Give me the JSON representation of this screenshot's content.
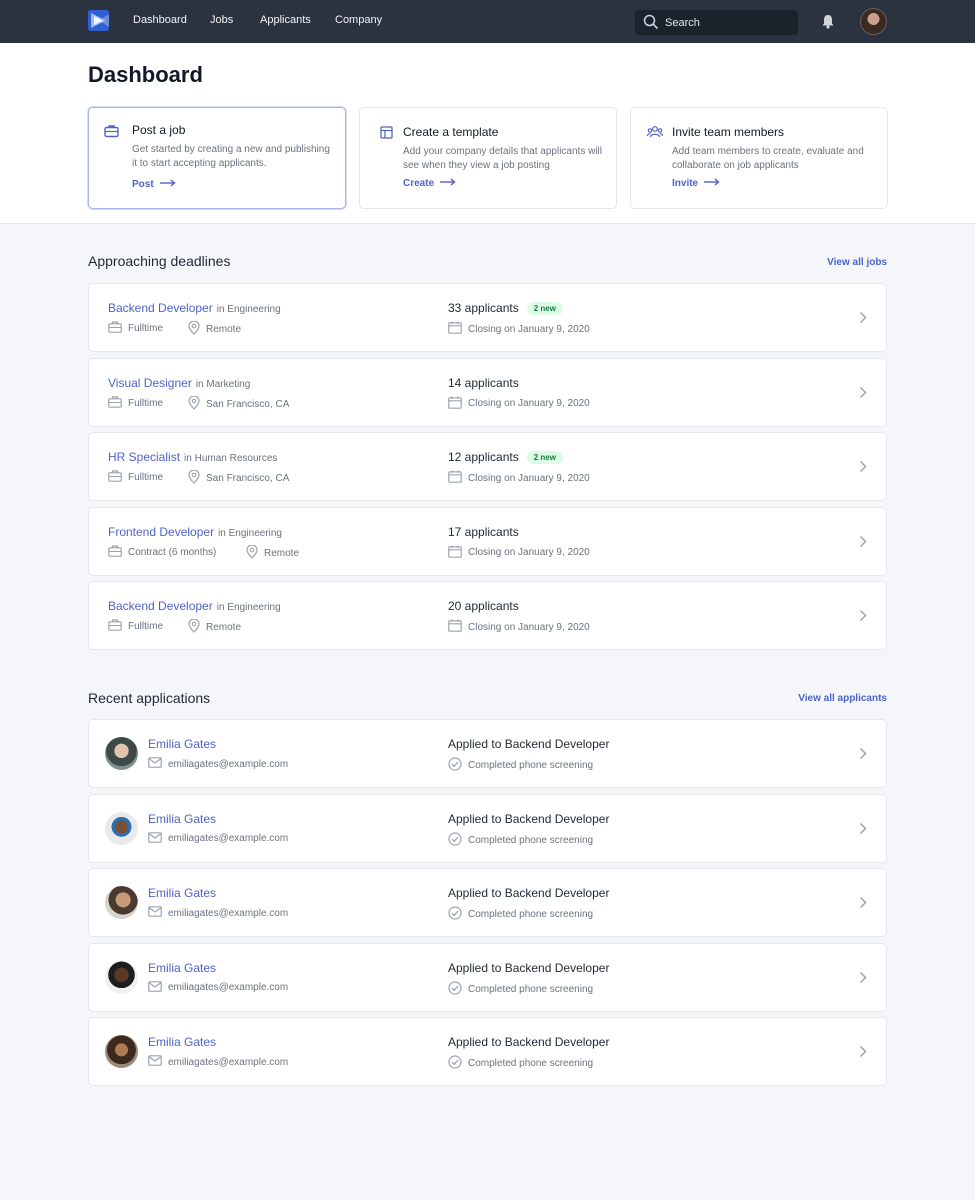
{
  "nav": {
    "links": [
      "Dashboard",
      "Jobs",
      "Applicants",
      "Company"
    ],
    "search_placeholder": "Search"
  },
  "page": {
    "title": "Dashboard"
  },
  "cards": [
    {
      "title": "Post a job",
      "desc": "Get started by creating a new and publishing it to start accepting applicants.",
      "link": "Post",
      "icon": "briefcase-icon"
    },
    {
      "title": "Create a template",
      "desc": "Add your company details that applicants will see when they view a job posting",
      "link": "Create",
      "icon": "template-icon"
    },
    {
      "title": "Invite team members",
      "desc": "Add team members to create, evaluate and collaborate on job applicants",
      "link": "Invite",
      "icon": "team-icon"
    }
  ],
  "deadlines": {
    "title": "Approaching deadlines",
    "view_all": "View all jobs",
    "jobs": [
      {
        "title": "Backend Developer",
        "dept": "in Engineering",
        "type": "Fulltime",
        "location": "Remote",
        "applicants": "33 applicants",
        "badge": "2 new",
        "closing": "Closing on January 9, 2020"
      },
      {
        "title": "Visual Designer",
        "dept": "in Marketing",
        "type": "Fulltime",
        "location": "San Francisco, CA",
        "applicants": "14 applicants",
        "badge": "",
        "closing": "Closing on January 9, 2020"
      },
      {
        "title": "HR Specialist",
        "dept": "in Human Resources",
        "type": "Fulltime",
        "location": "San Francisco, CA",
        "applicants": "12 applicants",
        "badge": "2 new",
        "closing": "Closing on January 9, 2020"
      },
      {
        "title": "Frontend Developer",
        "dept": "in Engineering",
        "type": "Contract (6 months)",
        "location": "Remote",
        "applicants": "17 applicants",
        "badge": "",
        "closing": "Closing on January 9, 2020"
      },
      {
        "title": "Backend Developer",
        "dept": "in Engineering",
        "type": "Fulltime",
        "location": "Remote",
        "applicants": "20 applicants",
        "badge": "",
        "closing": "Closing on January 9, 2020"
      }
    ]
  },
  "applications": {
    "title": "Recent applications",
    "view_all": "View all applicants",
    "items": [
      {
        "name": "Emilia Gates",
        "email": "emiliagates@example.com",
        "applied": "Applied to Backend Developer",
        "status": "Completed phone screening"
      },
      {
        "name": "Emilia Gates",
        "email": "emiliagates@example.com",
        "applied": "Applied to Backend Developer",
        "status": "Completed phone screening"
      },
      {
        "name": "Emilia Gates",
        "email": "emiliagates@example.com",
        "applied": "Applied to Backend Developer",
        "status": "Completed phone screening"
      },
      {
        "name": "Emilia Gates",
        "email": "emiliagates@example.com",
        "applied": "Applied to Backend Developer",
        "status": "Completed phone screening"
      },
      {
        "name": "Emilia Gates",
        "email": "emiliagates@example.com",
        "applied": "Applied to Backend Developer",
        "status": "Completed phone screening"
      }
    ]
  },
  "colors": {
    "nav_bg": "#2b3341",
    "accent": "#4f63c7",
    "badge_bg": "#dcfce7",
    "badge_text": "#15803d",
    "page_bg": "#f4f6fa"
  }
}
